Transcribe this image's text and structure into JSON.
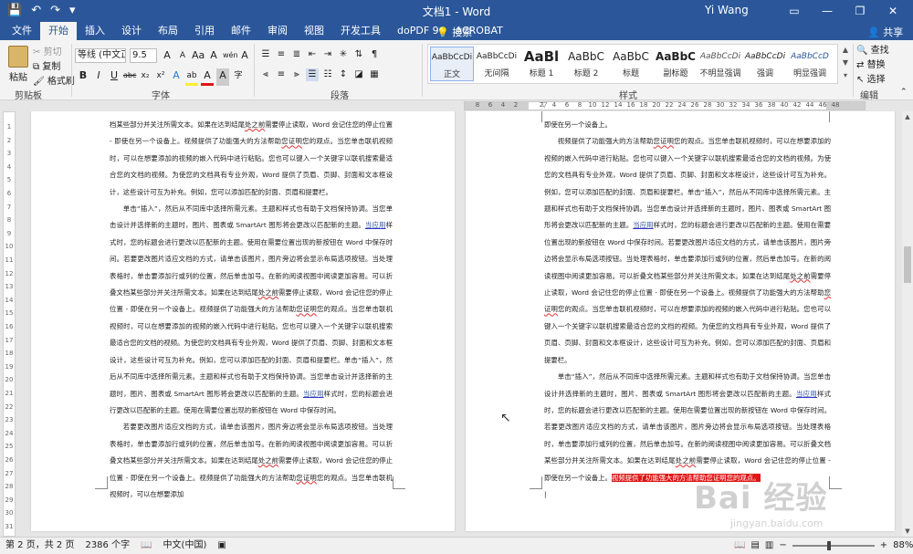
{
  "window": {
    "title": "文档1  -  Word",
    "user": "Yi Wang",
    "icons": [
      "save-icon",
      "undo-icon",
      "redo-icon",
      "customize-qat-icon",
      "ribbon-display-icon",
      "minimize-icon",
      "restore-icon",
      "close-icon"
    ]
  },
  "tabs": [
    {
      "label": "文件"
    },
    {
      "label": "开始"
    },
    {
      "label": "插入"
    },
    {
      "label": "设计"
    },
    {
      "label": "布局"
    },
    {
      "label": "引用"
    },
    {
      "label": "邮件"
    },
    {
      "label": "审阅"
    },
    {
      "label": "视图"
    },
    {
      "label": "开发工具"
    },
    {
      "label": "doPDF 9"
    },
    {
      "label": "ACROBAT"
    }
  ],
  "active_tab": "开始",
  "tell_me": "搜索",
  "share": "共享",
  "clipboard": {
    "paste": "粘贴",
    "cut": "剪切",
    "copy": "复制",
    "format_painter": "格式刷",
    "group": "剪贴板"
  },
  "font": {
    "name": "等线 (中文正文",
    "size": "9.5",
    "group": "字体",
    "grow": "A",
    "shrink": "A",
    "case": "Aa",
    "clear": "A",
    "wen": "wén",
    "box": "A",
    "bold": "B",
    "italic": "I",
    "underline": "U",
    "strike": "abc",
    "sub": "x₂",
    "sup": "x²",
    "effects": "A",
    "highlight": "ab",
    "color": "A",
    "shade": "A",
    "circle": "字"
  },
  "paragraph": {
    "group": "段落"
  },
  "styles": {
    "group": "样式",
    "items": [
      {
        "sample": "AaBbCcDi",
        "name": "正文"
      },
      {
        "sample": "AaBbCcDi",
        "name": "无间隔"
      },
      {
        "sample": "AaBl",
        "name": "标题 1"
      },
      {
        "sample": "AaBbC",
        "name": "标题 2"
      },
      {
        "sample": "AaBbC",
        "name": "标题"
      },
      {
        "sample": "AaBbC",
        "name": "副标题"
      },
      {
        "sample": "AaBbCcDi",
        "name": "不明显强调"
      },
      {
        "sample": "AaBbCcDi",
        "name": "强调"
      },
      {
        "sample": "AaBbCcD",
        "name": "明显强调"
      }
    ]
  },
  "editing": {
    "group": "编辑",
    "find": "查找",
    "replace": "替换",
    "select": "选择"
  },
  "ruler": {
    "numbers": [
      "8",
      "6",
      "4",
      "2",
      "",
      "2",
      "4",
      "6",
      "8",
      "10",
      "12",
      "14",
      "16",
      "18",
      "20",
      "22",
      "24",
      "26",
      "28",
      "30",
      "32",
      "34",
      "36",
      "38",
      "40",
      "42",
      "44",
      "46",
      "48"
    ],
    "vertical": [
      "1",
      "2",
      "3",
      "4",
      "5",
      "6",
      "7",
      "8",
      "9",
      "10",
      "11",
      "12",
      "13",
      "14",
      "15",
      "16",
      "17",
      "18",
      "19",
      "20",
      "21",
      "22",
      "23",
      "24",
      "25",
      "26",
      "27",
      "28",
      "29",
      "30",
      "31"
    ]
  },
  "page1": {
    "p0": "档某些部分并关注所需文本。如果在达到结尾",
    "p0u": "处之前",
    "p0b": "需要停止读取，Word 会记住您的停止位置 - 即使在另一个设备上。视频提供了功能强大的方法帮助",
    "p0u2": "您证明",
    "p0c": "您的观点。当您单击联机视频时，可以在想要添加的视频的嵌入代码中进行粘贴。您也可以键入一个关键字以联机搜索最适合您的文档的视频。为使您的文档具有专业外观，Word 提供了页眉、页脚、封面和文本框设计，这些设计可互为补充。例如，您可以添加匹配的封面、页眉和提要栏。",
    "p1": "单击“插入”，然后从不同库中选择所需元素。主题和样式也有助于文档保持协调。当您单击设计并选择新的主题时，图片、图表或 SmartArt 图形将会更改以匹配新的主题。",
    "p1u": "当应用",
    "p1b": "样式时，您的标题会进行更改以匹配新的主题。使用在需要位置出现的新按钮在 Word 中保存时间。若要更改图片适应文档的方式，请单击该图片，图片旁边将会显示布局选项按钮。当处理表格时，单击要添加行或列的位置，然后单击加号。在新的阅读视图中阅读更加容易。可以折叠文档某些部分并关注所需文本。如果在达到结尾",
    "p1u2": "处之前",
    "p1c": "需要停止读取，Word 会记住您的停止位置 - 即使在另一个设备上。视频提供了功能强大的方法帮助",
    "p1u3": "您证明",
    "p1d": "您的观点。当您单击联机视频时，可以在想要添加的视频的嵌入代码中进行粘贴。您也可以键入一个关键字以联机搜索最适合您的文档的视频。为使您的文档具有专业外观，Word 提供了页眉、页脚、封面和文本框设计，这些设计可互为补充。例如，您可以添加匹配的封面、页眉和提要栏。单击“插入”，然后从不同库中选择所需元素。主题和样式也有助于文档保持协调。当您单击设计并选择新的主题时，图片、图表或 SmartArt 图形将会更改以匹配新的主题。",
    "p1u4": "当应用",
    "p1e": "样式时，您的标题会进行更改以匹配新的主题。使用在需要位置出现的新按钮在 Word 中保存时间。",
    "p2": "若要更改图片适应文档的方式，请单击该图片，图片旁边将会显示布局选项按钮。当处理表格时，单击要添加行或列的位置，然后单击加号。在新的阅读视图中阅读更加容易。可以折叠文档某些部分并关注所需文本。如果在达到结尾",
    "p2u": "处之前",
    "p2b": "需要停止读取，Word 会记住您的停止位置 - 即使在另一个设备上。视频提供了功能强大的方法帮助",
    "p2u2": "您证明",
    "p2c": "您的观点。当您单击联机视频时，可以在想要添加"
  },
  "page2": {
    "p0": "即使在另一个设备上。",
    "p1": "视频提供了功能强大的方法帮助",
    "p1u": "您证明",
    "p1b": "您的观点。当您单击联机视频时，可以在想要添加的视频的嵌入代码中进行粘贴。您也可以键入一个关键字以联机搜索最适合您的文档的视频。为使您的文档具有专业外观，Word 提供了页眉、页脚、封面和文本框设计，这些设计可互为补充。例如，您可以添加匹配的封面、页眉和提要栏。单击“插入”，然后从不同库中选择所需元素。主题和样式也有助于文档保持协调。当您单击设计并选择新的主题时，图片、图表或 SmartArt 图形将会更改以匹配新的主题。",
    "p1u2": "当应用",
    "p1c": "样式时，您的标题会进行更改以匹配新的主题。使用在需要位置出现的新按钮在 Word 中保存时间。若要更改图片适应文档的方式，请单击该图片，图片旁边将会显示布局选项按钮。当处理表格时，单击要添加行或列的位置，然后单击加号。在新的阅读视图中阅读更加容易。可以折叠文档某些部分并关注所需文本。如果在达到结尾",
    "p1u3": "处之前",
    "p1d": "需要停止读取，Word 会记住您的停止位置 - 即使在另一个设备上。视频提供了功能强大的方法帮助",
    "p1u4": "您证明",
    "p1e": "您的观点。当您单击联机视频时，可以在想要添加的视频的嵌入代码中进行粘贴。您也可以键入一个关键字以联机搜索最适合您的文档的视频。为使您的文档具有专业外观，Word 提供了页眉、页脚、封面和文本框设计，这些设计可互为补充。例如，您可以添加匹配的封面、页眉和提要栏。",
    "p2": "单击“插入”，然后从不同库中选择所需元素。主题和样式也有助于文档保持协调。当您单击设计并选择新的主题时，图片、图表或 SmartArt 图形将会更改以匹配新的主题。",
    "p2u": "当应用",
    "p2b": "样式时，您的标题会进行更改以匹配新的主题。使用在需要位置出现的新按钮在 Word 中保存时间。若要更改图片适应文档的方式，请单击该图片，图片旁边将会显示布局选项按钮。当处理表格时，单击要添加行或列的位置，然后单击加号。在新的阅读视图中阅读更加容易。可以折叠文档某些部分并关注所需文本。如果在达到结尾",
    "p2u2": "处之前",
    "p2c": "需要停止读取，Word 会记住您的停止位置 - 即使在另一个设备上。",
    "p2hl": "视频提供了功能强大的方法帮助您证明您的观点。"
  },
  "status": {
    "page": "第 2 页，共 2 页",
    "words": "2386 个字",
    "language": "中文(中国)",
    "zoom": "88%",
    "zoom_fraction": 0.44
  },
  "watermark": {
    "brand": "Bai 经验",
    "url": "jingyan.baidu.com"
  },
  "colors": {
    "title_bar": "#2b579a",
    "highlight": "#e01515"
  }
}
